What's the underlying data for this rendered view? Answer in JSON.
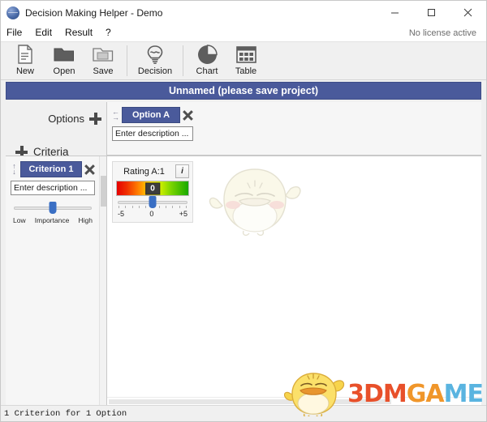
{
  "window": {
    "title": "Decision Making Helper - Demo",
    "app_icon": "globe-icon",
    "minimize": "minimize-icon",
    "maximize": "maximize-icon",
    "close": "close-icon",
    "license_status": "No license active"
  },
  "menu": {
    "items": [
      {
        "label": "File"
      },
      {
        "label": "Edit"
      },
      {
        "label": "Result"
      },
      {
        "label": "?"
      }
    ]
  },
  "toolbar": {
    "buttons": [
      {
        "label": "New",
        "icon": "new-document-icon"
      },
      {
        "label": "Open",
        "icon": "open-folder-icon"
      },
      {
        "label": "Save",
        "icon": "save-folder-icon"
      },
      {
        "label": "Decision",
        "icon": "lightbulb-icon"
      },
      {
        "label": "Chart",
        "icon": "pie-chart-icon"
      },
      {
        "label": "Table",
        "icon": "table-grid-icon"
      }
    ]
  },
  "banner": {
    "project_title": "Unnamed (please save project)",
    "color": "#4a5a9b"
  },
  "panels": {
    "options_header": {
      "label": "Options",
      "add_icon": "plus-icon"
    },
    "criteria_header": {
      "label": "Criteria",
      "add_icon": "plus-icon"
    }
  },
  "options": [
    {
      "name": "Option A",
      "description_placeholder": "Enter description ...",
      "move_icon": "move-horizontal-icon",
      "remove_icon": "close-icon"
    }
  ],
  "criteria": [
    {
      "name": "Criterion 1",
      "description_placeholder": "Enter description ...",
      "move_icon": "move-vertical-icon",
      "remove_icon": "close-icon",
      "importance_slider": {
        "low_label": "Low",
        "center_label": "Importance",
        "high_label": "High",
        "value_percent": 50
      }
    }
  ],
  "ratings": [
    {
      "title": "Rating A:1",
      "info_icon": "info-icon",
      "value": "0",
      "min_label": "-5",
      "mid_label": "0",
      "max_label": "+5",
      "value_percent": 50,
      "gradient_from": "#e60000",
      "gradient_mid": "#ffe000",
      "gradient_to": "#18a800"
    }
  ],
  "mascot": {
    "name": "chick-mascot-watermark"
  },
  "status_bar": {
    "text": "1 Criterion for 1 Option"
  },
  "watermark": {
    "part1": "3DM",
    "part2": "GA",
    "part3": "ME",
    "mascot": "chick-mascot-icon"
  }
}
